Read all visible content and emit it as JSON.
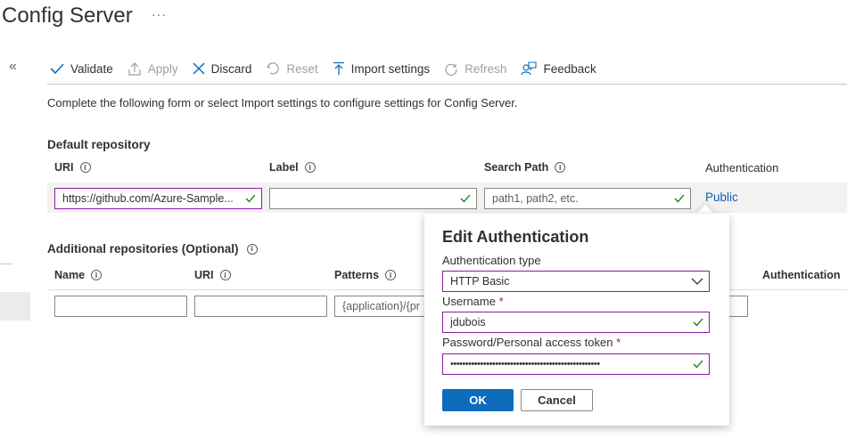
{
  "page": {
    "title": "Config Server",
    "more": "···",
    "collapse": "«"
  },
  "toolbar": {
    "validate": "Validate",
    "apply": "Apply",
    "discard": "Discard",
    "reset": "Reset",
    "import": "Import settings",
    "refresh": "Refresh",
    "feedback": "Feedback"
  },
  "description": "Complete the following form or select Import settings to configure settings for Config Server.",
  "default_repo": {
    "title": "Default repository",
    "columns": {
      "uri": "URI",
      "label": "Label",
      "search_path": "Search Path",
      "authentication": "Authentication"
    },
    "uri_value": "https://github.com/Azure-Sample...",
    "label_value": "",
    "search_path_placeholder": "path1, path2, etc.",
    "auth_link": "Public"
  },
  "additional_repos": {
    "title": "Additional repositories (Optional)",
    "columns": {
      "name": "Name",
      "uri": "URI",
      "patterns": "Patterns",
      "authentication": "Authentication"
    },
    "patterns_placeholder": "{application}/{pr"
  },
  "edit_auth": {
    "title": "Edit Authentication",
    "auth_type_label": "Authentication type",
    "auth_type_value": "HTTP Basic",
    "username_label": "Username",
    "username_value": "jdubois",
    "password_label": "Password/Personal access token",
    "password_value": "••••••••••••••••••••••••••••••••••••••••••••••••••",
    "required_mark": "*",
    "ok": "OK",
    "cancel": "Cancel"
  },
  "info_glyph": "i",
  "colors": {
    "accent": "#0f6cbd",
    "focus_border": "#8a1ba1",
    "link": "#0f62b4",
    "required": "#a4262c"
  }
}
